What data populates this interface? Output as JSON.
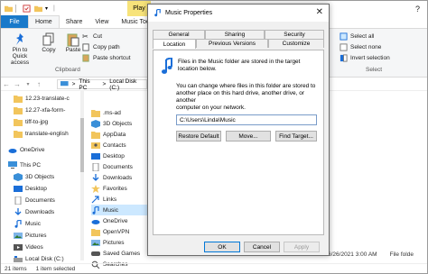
{
  "explorer": {
    "play_tab": "Play",
    "ribbon_tabs": {
      "file": "File",
      "home": "Home",
      "share": "Share",
      "view": "View",
      "music_tools": "Music Tool"
    },
    "ribbon": {
      "pin_label_1": "Pin to Quick",
      "pin_label_2": "access",
      "copy": "Copy",
      "paste": "Paste",
      "cut": "Cut",
      "copy_path": "Copy path",
      "paste_shortcut": "Paste shortcut",
      "clipboard_group": "Clipboard",
      "select_all": "Select all",
      "select_none": "Select none",
      "invert_selection": "Invert selection",
      "select_group": "Select"
    },
    "address": {
      "this_pc": "This PC",
      "sep": ">",
      "drive": "Local Disk (C:)"
    },
    "nav_items": [
      "12.23-translate-c",
      "12.27-xfa-form-",
      "tiff-to-jpg",
      "translate-english",
      "OneDrive",
      "This PC",
      "3D Objects",
      "Desktop",
      "Documents",
      "Downloads",
      "Music",
      "Pictures",
      "Videos",
      "Local Disk (C:)"
    ],
    "file_items": [
      ".ms-ad",
      "3D Objects",
      "AppData",
      "Contacts",
      "Desktop",
      "Documents",
      "Downloads",
      "Favorites",
      "Links",
      "Music",
      "OneDrive",
      "OpenVPN",
      "Pictures",
      "Saved Games",
      "Searches"
    ],
    "right_col": {
      "date": "6/26/2021 3:00 AM",
      "type": "File folde"
    },
    "status": {
      "count": "21 items",
      "selected": "1 item selected"
    }
  },
  "dialog": {
    "title": "Music Properties",
    "tabs_row1": [
      "General",
      "Sharing",
      "Security"
    ],
    "tabs_row2": [
      "Location",
      "Previous Versions",
      "Customize"
    ],
    "desc_line1": "Files in the Music folder are stored in the target",
    "desc_line2": "location below.",
    "change_line1": "You can change where files in this folder are stored to",
    "change_line2": "another place on this hard drive, another drive, or another",
    "change_line3": "computer on your network.",
    "path_value": "C:\\Users\\Linda\\Music",
    "restore_default": "Restore Default",
    "move": "Move...",
    "find_target": "Find Target...",
    "ok": "OK",
    "cancel": "Cancel",
    "apply": "Apply"
  },
  "colors": {
    "accent": "#1979ca",
    "play_tab": "#f7e37a",
    "selection": "#cce8ff",
    "folder": "#f2c55c",
    "music": "#1a6ed8"
  }
}
